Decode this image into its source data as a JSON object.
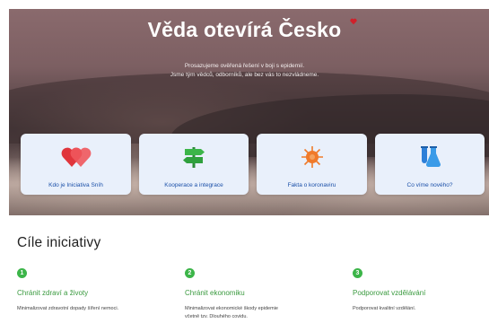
{
  "hero": {
    "title": "Věda otevírá Česko",
    "subtitle_line1": "Prosazujeme ověřená řešení v boji s epidemií.",
    "subtitle_line2": "Jsme tým vědců, odborníků, ale bez vás to nezvládneme.",
    "heart_color": "#d0202a"
  },
  "cards": [
    {
      "label": "Kdo je Iniciativa Sníh",
      "icon": "hearts-icon"
    },
    {
      "label": "Kooperace a integrace",
      "icon": "signpost-icon"
    },
    {
      "label": "Fakta o koronaviru",
      "icon": "virus-icon"
    },
    {
      "label": "Co víme nového?",
      "icon": "flask-icon"
    }
  ],
  "section": {
    "title": "Cíle iniciativy"
  },
  "goals": [
    {
      "number": "1",
      "title": "Chránit zdraví a životy",
      "desc_line1": "Minimalizovat zdravotní dopady šíření nemoci.",
      "desc_line2": ""
    },
    {
      "number": "2",
      "title": "Chránit ekonomiku",
      "desc_line1": "Minimalizovat ekonomické škody epidemie",
      "desc_line2": "včetně tzv. Dlouhého covidu."
    },
    {
      "number": "3",
      "title": "Podporovat vzdělávání",
      "desc_line1": "Podporovat kvalitní vzdělání.",
      "desc_line2": ""
    }
  ],
  "colors": {
    "accent_green": "#3cb549",
    "card_bg": "#e9f0fb",
    "card_label": "#1a4fa8"
  }
}
